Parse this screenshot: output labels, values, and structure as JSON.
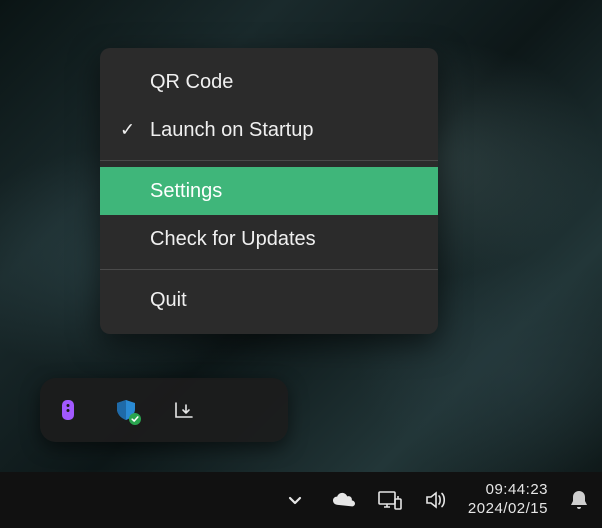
{
  "context_menu": {
    "items": [
      {
        "label": "QR Code",
        "highlighted": false,
        "checked": false
      },
      {
        "label": "Launch on Startup",
        "highlighted": false,
        "checked": true
      },
      {
        "label": "Settings",
        "highlighted": true,
        "checked": false
      },
      {
        "label": "Check for Updates",
        "highlighted": false,
        "checked": false
      },
      {
        "label": "Quit",
        "highlighted": false,
        "checked": false
      }
    ],
    "check_glyph": "✓"
  },
  "taskbar": {
    "time": "09:44:23",
    "date": "2024/02/15"
  }
}
